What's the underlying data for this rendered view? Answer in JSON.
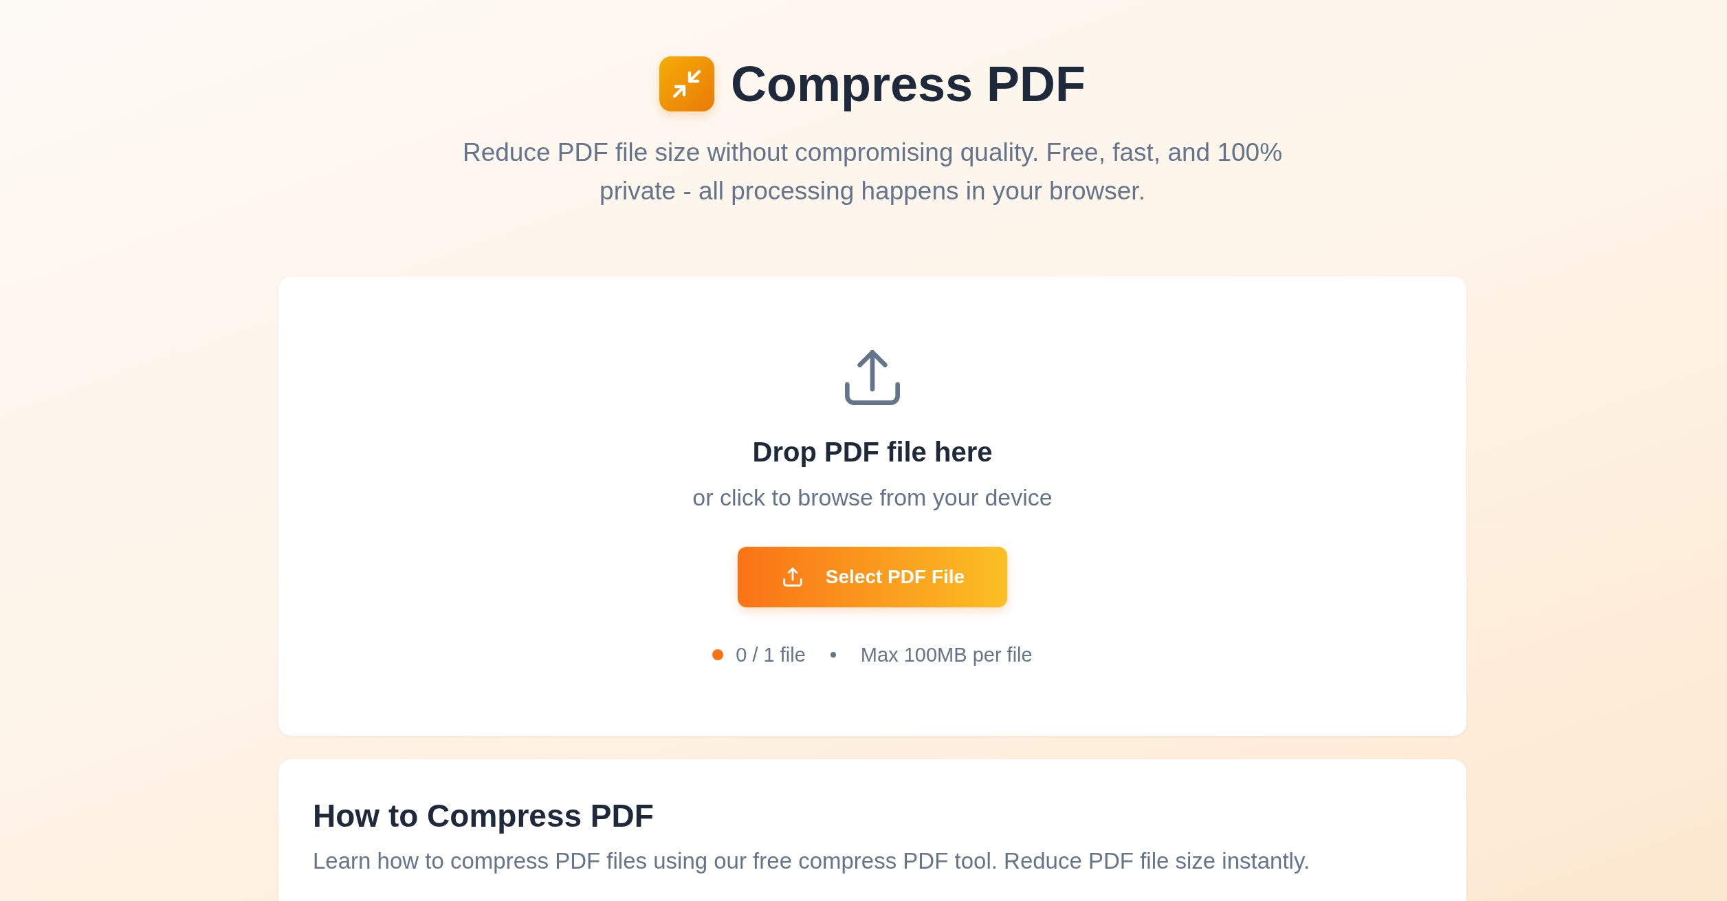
{
  "header": {
    "title": "Compress PDF",
    "subtitle": "Reduce PDF file size without compromising quality. Free, fast, and 100% private - all processing happens in your browser."
  },
  "upload": {
    "heading": "Drop PDF file here",
    "hint": "or click to browse from your device",
    "button": "Select PDF File",
    "file_count": "0 / 1 file",
    "limit": "Max 100MB per file"
  },
  "guide": {
    "heading": "How to Compress PDF",
    "description": "Learn how to compress PDF files using our free compress PDF tool. Reduce PDF file size instantly."
  }
}
